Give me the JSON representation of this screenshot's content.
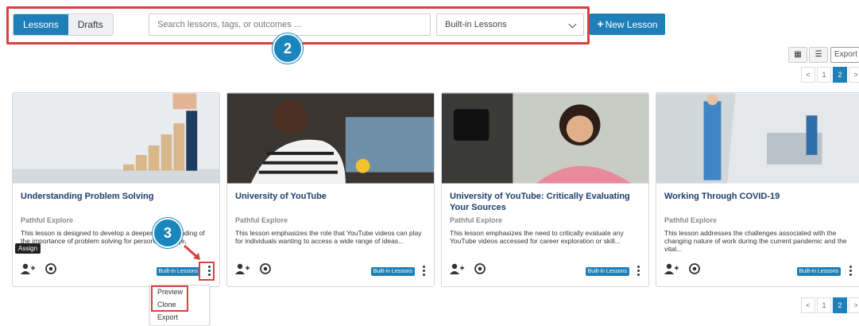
{
  "tabs": [
    {
      "label": "Lessons",
      "active": true
    },
    {
      "label": "Drafts",
      "active": false
    }
  ],
  "search": {
    "placeholder": "Search lessons, tags, or outcomes ..."
  },
  "filter": {
    "selected": "Built-in Lessons"
  },
  "new_lesson": {
    "plus": "+",
    "label": "New Lesson"
  },
  "steps": {
    "two": "2",
    "three": "3"
  },
  "toolbar": {
    "grid_icon": "▦",
    "list_icon": "☰",
    "export_label": "Export"
  },
  "pager_top": {
    "prev": "<",
    "pages": [
      "1",
      "2"
    ],
    "current": "2",
    "next": ">"
  },
  "pager_bottom": {
    "prev": "<",
    "pages": [
      "1",
      "2"
    ],
    "current": "2",
    "next": ">"
  },
  "cards": [
    {
      "title": "Understanding Problem Solving",
      "provider": "Pathful Explore",
      "description": "This lesson is designed to develop a deeper understanding of the importance of problem solving for personal, college,",
      "badge": "Built-in Lessons"
    },
    {
      "title": "University of YouTube",
      "provider": "Pathful Explore",
      "description": "This lesson emphasizes the role that YouTube videos can play for individuals wanting to access a wide range of ideas...",
      "badge": "Built-in Lessons"
    },
    {
      "title": "University of YouTube: Critically Evaluating Your Sources",
      "provider": "Pathful Explore",
      "description": "This lesson emphasizes the need to critically evaluate any YouTube videos accessed for career exploration or skill...",
      "badge": "Built-in Lessons"
    },
    {
      "title": "Working Through COVID-19",
      "provider": "Pathful Explore",
      "description": "This lesson addresses the challenges associated with the changing nature of work during the current pandemic and the vital...",
      "badge": "Built-in Lessons"
    }
  ],
  "tooltip": {
    "assign": "Assign"
  },
  "context_menu": {
    "items": [
      "Preview",
      "Clone",
      "Export"
    ]
  },
  "colors": {
    "accent": "#1f7fb9",
    "highlight": "#d9413e",
    "step_circle": "#1b86bd",
    "title": "#1a3d6b"
  }
}
